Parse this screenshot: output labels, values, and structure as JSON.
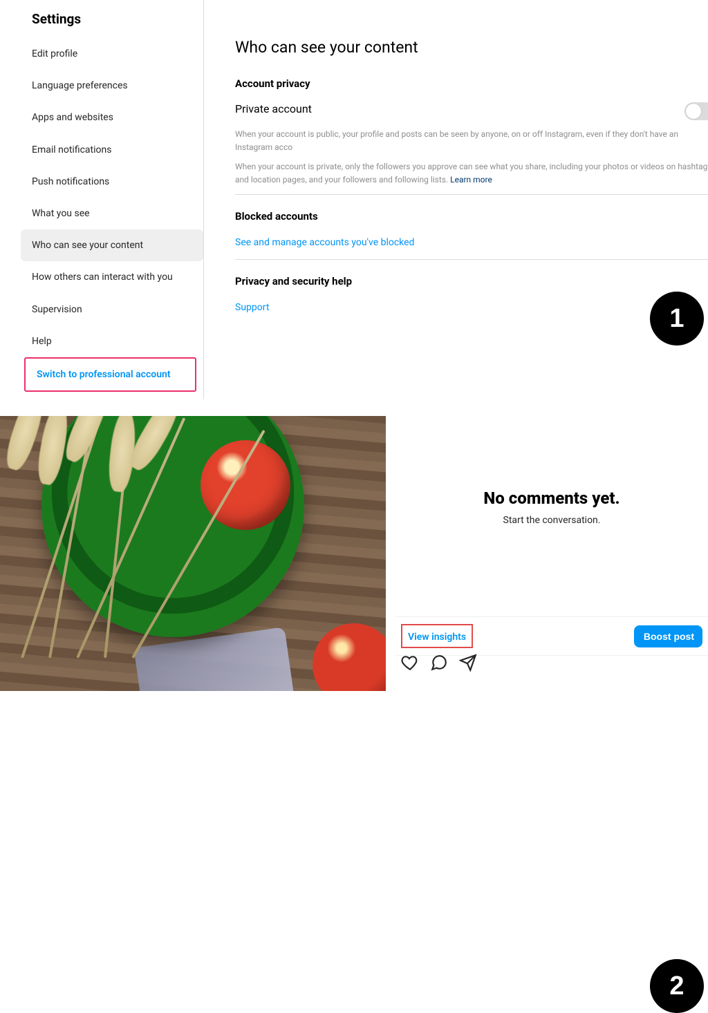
{
  "settings": {
    "title": "Settings",
    "items": [
      "Edit profile",
      "Language preferences",
      "Apps and websites",
      "Email notifications",
      "Push notifications",
      "What you see",
      "Who can see your content",
      "How others can interact with you",
      "Supervision",
      "Help"
    ],
    "activeIndex": 6,
    "switchLabel": "Switch to professional account"
  },
  "privacy": {
    "pageTitle": "Who can see your content",
    "accountPrivacyHeading": "Account privacy",
    "privateLabel": "Private account",
    "desc1": "When your account is public, your profile and posts can be seen by anyone, on or off Instagram, even if they don't have an Instagram acco",
    "desc2": "When your account is private, only the followers you approve can see what you share, including your photos or videos on hashtag and location pages, and your followers and following lists. ",
    "learnMore": "Learn more",
    "blockedHeading": "Blocked accounts",
    "blockedLink": "See and manage accounts you've blocked",
    "helpHeading": "Privacy and security help",
    "supportLink": "Support"
  },
  "steps": {
    "one": "1",
    "two": "2"
  },
  "post": {
    "noCommentsTitle": "No comments yet.",
    "noCommentsSub": "Start the conversation.",
    "viewInsights": "View insights",
    "boost": "Boost post"
  }
}
